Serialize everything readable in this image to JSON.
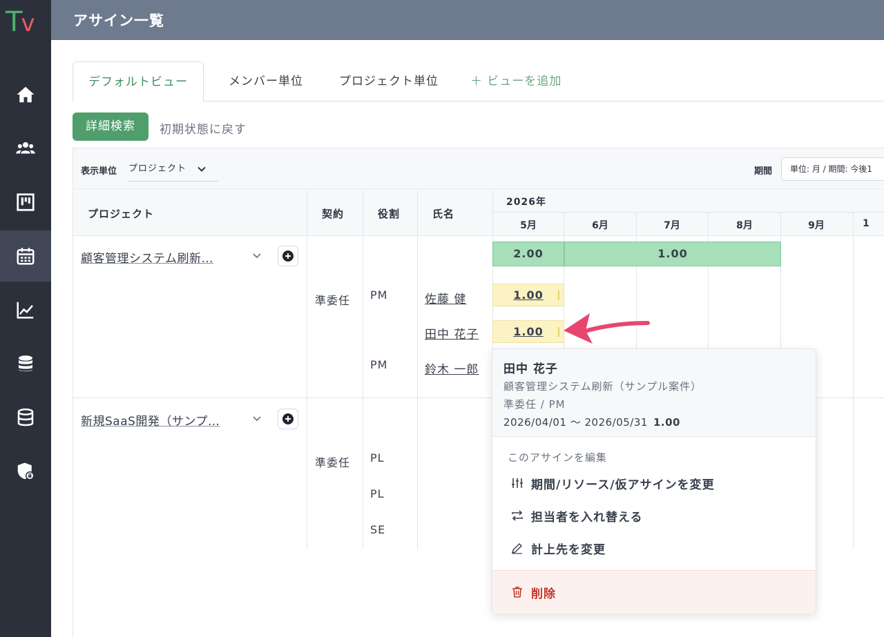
{
  "app": {
    "logo": {
      "t": "T",
      "v": "v"
    },
    "title": "アサイン一覧"
  },
  "sidebar": {
    "items": [
      {
        "icon": "home-icon"
      },
      {
        "icon": "users-icon"
      },
      {
        "icon": "board-icon"
      },
      {
        "icon": "calendar-icon",
        "active": true
      },
      {
        "icon": "chart-icon"
      },
      {
        "icon": "database-icon"
      },
      {
        "icon": "database-outline-icon"
      },
      {
        "icon": "shield-lock-icon"
      }
    ]
  },
  "tabs": {
    "default": "デフォルトビュー",
    "member": "メンバー単位",
    "project": "プロジェクト単位",
    "add": "＋ ビューを追加"
  },
  "actions": {
    "search": "詳細検索",
    "reset": "初期状態に戻す"
  },
  "toolbar": {
    "unit_label": "表示単位",
    "unit_value": "プロジェクト",
    "period_label": "期間",
    "period_value": "単位: 月 / 期間: 今後1"
  },
  "table": {
    "headers": {
      "project": "プロジェクト",
      "contract": "契約",
      "role": "役割",
      "name": "氏名",
      "year": "2026年"
    },
    "months": [
      "5月",
      "6月",
      "7月",
      "8月",
      "9月",
      "1"
    ],
    "projects": [
      {
        "name": "顧客管理システム刷新…",
        "contract": "準委任",
        "summary": [
          "2.00",
          "1.00"
        ],
        "rows": [
          {
            "role": "PM",
            "person": "佐藤 健",
            "value": "1.00"
          },
          {
            "role": "",
            "person": "田中 花子",
            "value": "1.00"
          },
          {
            "role": "PM",
            "person": "鈴木 一郎",
            "value": ""
          }
        ]
      },
      {
        "name": "新規SaaS開発（サンプ…",
        "contract": "準委任",
        "rows": [
          {
            "role": "PL"
          },
          {
            "role": "PL"
          },
          {
            "role": "SE"
          }
        ]
      }
    ]
  },
  "popup": {
    "name": "田中 花子",
    "project": "顧客管理システム刷新（サンプル案件）",
    "role": "準委任 / PM",
    "dates": "2026/04/01 〜 2026/05/31",
    "value": "1.00",
    "section": "このアサインを編集",
    "edit_period": "期間/リソース/仮アサインを変更",
    "swap": "担当者を入れ替える",
    "billing": "計上先を変更",
    "delete": "削除"
  },
  "colors": {
    "sidebar": "#2b303b",
    "topbar": "#6e7a8e",
    "accent_green": "#4f9e6c",
    "bar_green": "#a6dfba",
    "bar_yellow": "#fbf3c4",
    "danger": "#c0392b",
    "arrow": "#e8466f"
  }
}
